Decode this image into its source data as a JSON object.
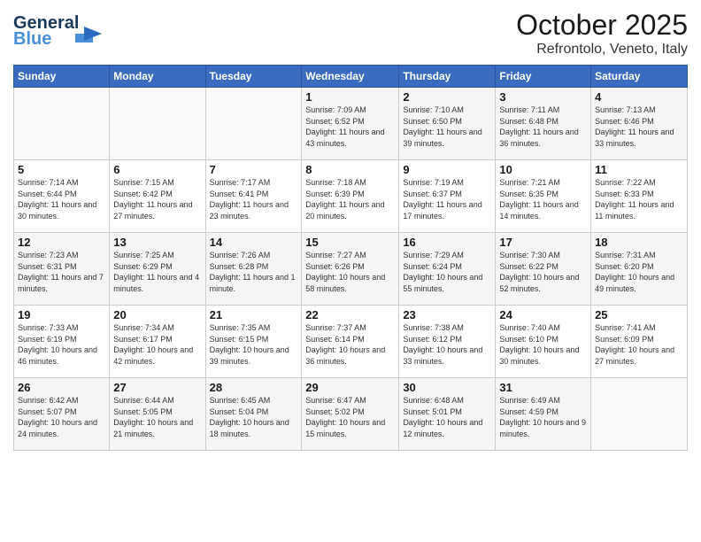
{
  "header": {
    "logo_line1": "General",
    "logo_line2": "Blue",
    "month": "October 2025",
    "location": "Refrontolo, Veneto, Italy"
  },
  "weekdays": [
    "Sunday",
    "Monday",
    "Tuesday",
    "Wednesday",
    "Thursday",
    "Friday",
    "Saturday"
  ],
  "weeks": [
    [
      {
        "day": "",
        "sunrise": "",
        "sunset": "",
        "daylight": ""
      },
      {
        "day": "",
        "sunrise": "",
        "sunset": "",
        "daylight": ""
      },
      {
        "day": "",
        "sunrise": "",
        "sunset": "",
        "daylight": ""
      },
      {
        "day": "1",
        "sunrise": "Sunrise: 7:09 AM",
        "sunset": "Sunset: 6:52 PM",
        "daylight": "Daylight: 11 hours and 43 minutes."
      },
      {
        "day": "2",
        "sunrise": "Sunrise: 7:10 AM",
        "sunset": "Sunset: 6:50 PM",
        "daylight": "Daylight: 11 hours and 39 minutes."
      },
      {
        "day": "3",
        "sunrise": "Sunrise: 7:11 AM",
        "sunset": "Sunset: 6:48 PM",
        "daylight": "Daylight: 11 hours and 36 minutes."
      },
      {
        "day": "4",
        "sunrise": "Sunrise: 7:13 AM",
        "sunset": "Sunset: 6:46 PM",
        "daylight": "Daylight: 11 hours and 33 minutes."
      }
    ],
    [
      {
        "day": "5",
        "sunrise": "Sunrise: 7:14 AM",
        "sunset": "Sunset: 6:44 PM",
        "daylight": "Daylight: 11 hours and 30 minutes."
      },
      {
        "day": "6",
        "sunrise": "Sunrise: 7:15 AM",
        "sunset": "Sunset: 6:42 PM",
        "daylight": "Daylight: 11 hours and 27 minutes."
      },
      {
        "day": "7",
        "sunrise": "Sunrise: 7:17 AM",
        "sunset": "Sunset: 6:41 PM",
        "daylight": "Daylight: 11 hours and 23 minutes."
      },
      {
        "day": "8",
        "sunrise": "Sunrise: 7:18 AM",
        "sunset": "Sunset: 6:39 PM",
        "daylight": "Daylight: 11 hours and 20 minutes."
      },
      {
        "day": "9",
        "sunrise": "Sunrise: 7:19 AM",
        "sunset": "Sunset: 6:37 PM",
        "daylight": "Daylight: 11 hours and 17 minutes."
      },
      {
        "day": "10",
        "sunrise": "Sunrise: 7:21 AM",
        "sunset": "Sunset: 6:35 PM",
        "daylight": "Daylight: 11 hours and 14 minutes."
      },
      {
        "day": "11",
        "sunrise": "Sunrise: 7:22 AM",
        "sunset": "Sunset: 6:33 PM",
        "daylight": "Daylight: 11 hours and 11 minutes."
      }
    ],
    [
      {
        "day": "12",
        "sunrise": "Sunrise: 7:23 AM",
        "sunset": "Sunset: 6:31 PM",
        "daylight": "Daylight: 11 hours and 7 minutes."
      },
      {
        "day": "13",
        "sunrise": "Sunrise: 7:25 AM",
        "sunset": "Sunset: 6:29 PM",
        "daylight": "Daylight: 11 hours and 4 minutes."
      },
      {
        "day": "14",
        "sunrise": "Sunrise: 7:26 AM",
        "sunset": "Sunset: 6:28 PM",
        "daylight": "Daylight: 11 hours and 1 minute."
      },
      {
        "day": "15",
        "sunrise": "Sunrise: 7:27 AM",
        "sunset": "Sunset: 6:26 PM",
        "daylight": "Daylight: 10 hours and 58 minutes."
      },
      {
        "day": "16",
        "sunrise": "Sunrise: 7:29 AM",
        "sunset": "Sunset: 6:24 PM",
        "daylight": "Daylight: 10 hours and 55 minutes."
      },
      {
        "day": "17",
        "sunrise": "Sunrise: 7:30 AM",
        "sunset": "Sunset: 6:22 PM",
        "daylight": "Daylight: 10 hours and 52 minutes."
      },
      {
        "day": "18",
        "sunrise": "Sunrise: 7:31 AM",
        "sunset": "Sunset: 6:20 PM",
        "daylight": "Daylight: 10 hours and 49 minutes."
      }
    ],
    [
      {
        "day": "19",
        "sunrise": "Sunrise: 7:33 AM",
        "sunset": "Sunset: 6:19 PM",
        "daylight": "Daylight: 10 hours and 46 minutes."
      },
      {
        "day": "20",
        "sunrise": "Sunrise: 7:34 AM",
        "sunset": "Sunset: 6:17 PM",
        "daylight": "Daylight: 10 hours and 42 minutes."
      },
      {
        "day": "21",
        "sunrise": "Sunrise: 7:35 AM",
        "sunset": "Sunset: 6:15 PM",
        "daylight": "Daylight: 10 hours and 39 minutes."
      },
      {
        "day": "22",
        "sunrise": "Sunrise: 7:37 AM",
        "sunset": "Sunset: 6:14 PM",
        "daylight": "Daylight: 10 hours and 36 minutes."
      },
      {
        "day": "23",
        "sunrise": "Sunrise: 7:38 AM",
        "sunset": "Sunset: 6:12 PM",
        "daylight": "Daylight: 10 hours and 33 minutes."
      },
      {
        "day": "24",
        "sunrise": "Sunrise: 7:40 AM",
        "sunset": "Sunset: 6:10 PM",
        "daylight": "Daylight: 10 hours and 30 minutes."
      },
      {
        "day": "25",
        "sunrise": "Sunrise: 7:41 AM",
        "sunset": "Sunset: 6:09 PM",
        "daylight": "Daylight: 10 hours and 27 minutes."
      }
    ],
    [
      {
        "day": "26",
        "sunrise": "Sunrise: 6:42 AM",
        "sunset": "Sunset: 5:07 PM",
        "daylight": "Daylight: 10 hours and 24 minutes."
      },
      {
        "day": "27",
        "sunrise": "Sunrise: 6:44 AM",
        "sunset": "Sunset: 5:05 PM",
        "daylight": "Daylight: 10 hours and 21 minutes."
      },
      {
        "day": "28",
        "sunrise": "Sunrise: 6:45 AM",
        "sunset": "Sunset: 5:04 PM",
        "daylight": "Daylight: 10 hours and 18 minutes."
      },
      {
        "day": "29",
        "sunrise": "Sunrise: 6:47 AM",
        "sunset": "Sunset: 5:02 PM",
        "daylight": "Daylight: 10 hours and 15 minutes."
      },
      {
        "day": "30",
        "sunrise": "Sunrise: 6:48 AM",
        "sunset": "Sunset: 5:01 PM",
        "daylight": "Daylight: 10 hours and 12 minutes."
      },
      {
        "day": "31",
        "sunrise": "Sunrise: 6:49 AM",
        "sunset": "Sunset: 4:59 PM",
        "daylight": "Daylight: 10 hours and 9 minutes."
      },
      {
        "day": "",
        "sunrise": "",
        "sunset": "",
        "daylight": ""
      }
    ]
  ]
}
